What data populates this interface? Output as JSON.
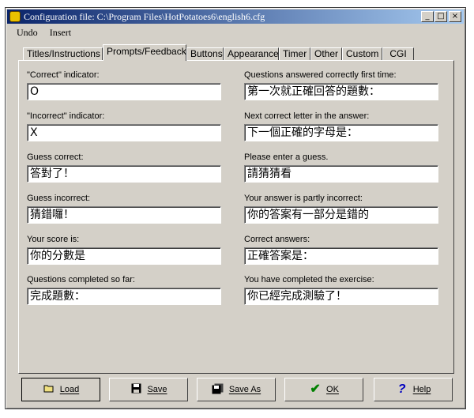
{
  "window": {
    "title": "Configuration file: C:\\Program Files\\HotPotatoes6\\english6.cfg"
  },
  "titlebar_buttons": {
    "minimize": "_",
    "maximize": "□",
    "close": "×"
  },
  "menu": [
    "Undo",
    "Insert"
  ],
  "tabs": [
    "Titles/Instructions",
    "Prompts/Feedback",
    "Buttons",
    "Appearance",
    "Timer",
    "Other",
    "Custom",
    "CGI"
  ],
  "active_tab": "Prompts/Feedback",
  "left_fields": [
    {
      "label": "\"Correct\" indicator:",
      "value": "O"
    },
    {
      "label": "\"Incorrect\" indicator:",
      "value": "X"
    },
    {
      "label": "Guess correct:",
      "value": "答對了！"
    },
    {
      "label": "Guess incorrect:",
      "value": "猜錯囉！"
    },
    {
      "label": "Your score is:",
      "value": "你的分數是"
    },
    {
      "label": "Questions completed so far:",
      "value": "完成題數："
    }
  ],
  "right_fields": [
    {
      "label": "Questions answered correctly first time:",
      "value": "第一次就正確回答的題數："
    },
    {
      "label": "Next correct letter in the answer:",
      "value": "下一個正確的字母是："
    },
    {
      "label": "Please enter a guess.",
      "value": "請猜猜看"
    },
    {
      "label": "Your answer is partly incorrect:",
      "value": "你的答案有一部分是錯的"
    },
    {
      "label": "Correct answers:",
      "value": "正確答案是："
    },
    {
      "label": "You have completed the exercise:",
      "value": "你已經完成測驗了！"
    }
  ],
  "buttons": {
    "load": "Load",
    "save": "Save",
    "save_as": "Save As",
    "ok": "OK",
    "help": "Help"
  },
  "colors": {
    "titlebar_start": "#0a246a",
    "titlebar_end": "#a6caf0",
    "face": "#d4d0c8",
    "ok_check": "#008000",
    "help_q": "#0000c0"
  },
  "icons": {
    "load": "folder-icon",
    "save": "floppy-disk-icon",
    "save_as": "floppy-disks-icon",
    "ok": "check-icon",
    "help": "question-mark-icon"
  }
}
